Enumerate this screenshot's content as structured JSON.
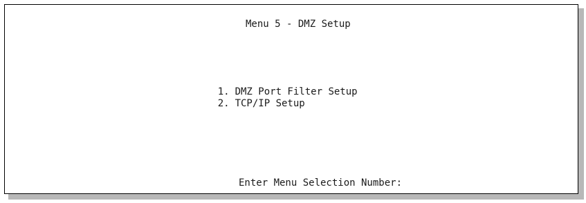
{
  "screen": {
    "title": "Menu 5 - DMZ Setup",
    "menu_items": [
      {
        "number": "1.",
        "label": "DMZ Port Filter Setup"
      },
      {
        "number": "2.",
        "label": "TCP/IP Setup"
      }
    ],
    "prompt": "Enter Menu Selection Number:"
  }
}
